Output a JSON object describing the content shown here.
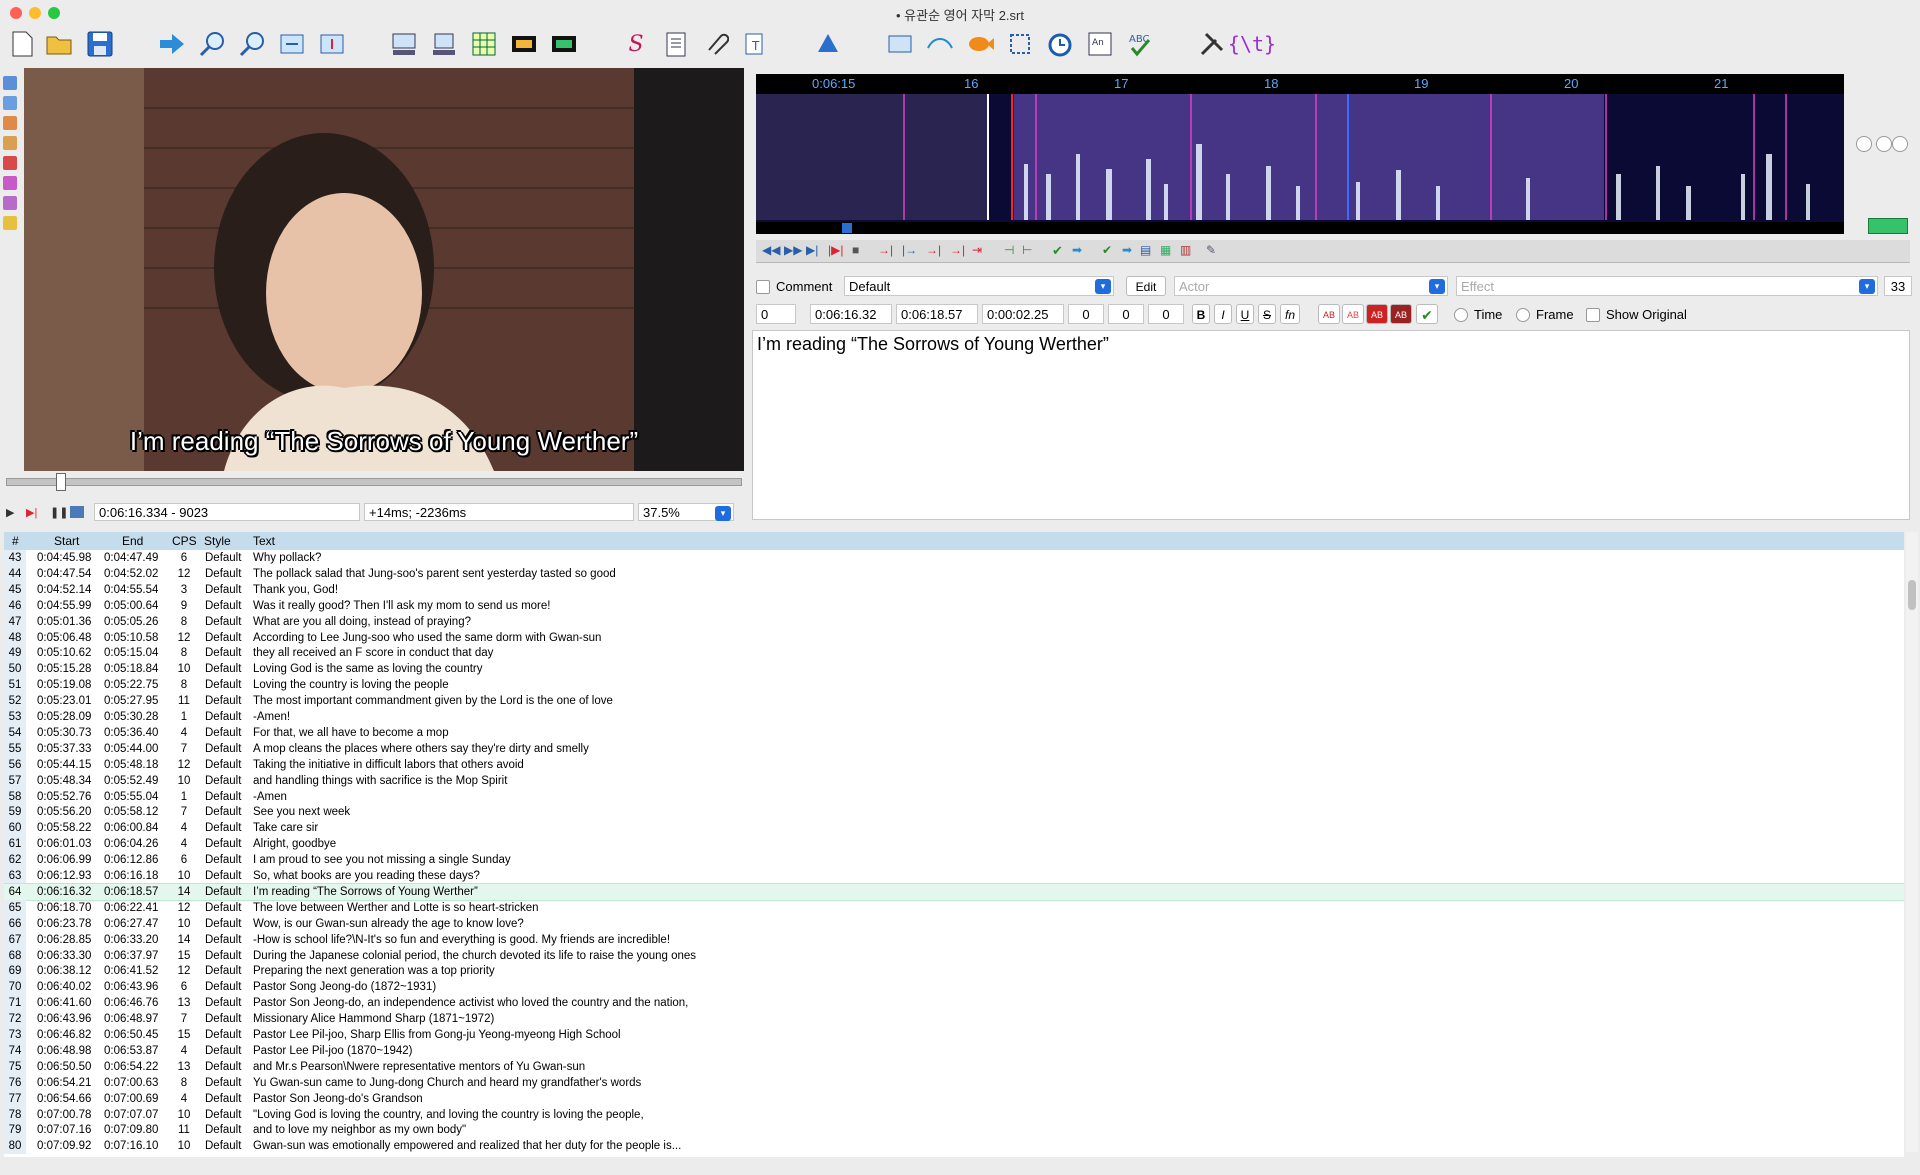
{
  "window": {
    "title": "• 유관순 영어 자막 2.srt"
  },
  "toolbar": {
    "icons": [
      "new-icon",
      "open-icon",
      "save-icon",
      "jump-icon",
      "zoom-in-icon",
      "zoom-out-icon",
      "video-fit-icon",
      "video-detach-icon",
      "layout-1-icon",
      "layout-2-icon",
      "grid-icon",
      "filmstrip-icon",
      "filmstrip-alt-icon",
      "styles-icon",
      "properties-icon",
      "attachments-icon",
      "fonts-icon",
      "automation-icon",
      "translation-icon",
      "timing-icon",
      "fish-icon",
      "select-icon",
      "clock-icon",
      "resample-icon",
      "spellcheck-icon",
      "tools-icon",
      "variables-icon"
    ]
  },
  "video": {
    "subtitle_overlay": "I’m reading “The Sorrows of Young Werther”",
    "position": "0:06:16.334 - 9023",
    "offset": "+14ms; -2236ms",
    "zoom": "37.5%"
  },
  "audio": {
    "ruler": [
      "0:06:15",
      "16",
      "17",
      "18",
      "19",
      "20",
      "21"
    ]
  },
  "editor": {
    "comment_label": "Comment",
    "style": "Default",
    "edit_label": "Edit",
    "actor_placeholder": "Actor",
    "effect_placeholder": "Effect",
    "char_count": "33",
    "layer": "0",
    "start": "0:06:16.32",
    "end": "0:06:18.57",
    "duration": "0:00:02.25",
    "margin_l": "0",
    "margin_r": "0",
    "margin_v": "0",
    "bold": "B",
    "italic": "I",
    "underline": "U",
    "strike": "S",
    "font": "fn",
    "ab": "AB",
    "time_label": "Time",
    "frame_label": "Frame",
    "show_original_label": "Show Original",
    "text": "I’m reading “The Sorrows of Young Werther”"
  },
  "grid": {
    "headers": {
      "num": "#",
      "start": "Start",
      "end": "End",
      "cps": "CPS",
      "style": "Style",
      "text": "Text"
    },
    "rows": [
      {
        "n": "43",
        "s": "0:04:45.98",
        "e": "0:04:47.49",
        "c": "6",
        "st": "Default",
        "t": "Why pollack?"
      },
      {
        "n": "44",
        "s": "0:04:47.54",
        "e": "0:04:52.02",
        "c": "12",
        "st": "Default",
        "t": "The pollack salad that Jung-soo's parent sent yesterday tasted so good"
      },
      {
        "n": "45",
        "s": "0:04:52.14",
        "e": "0:04:55.54",
        "c": "3",
        "st": "Default",
        "t": "Thank you, God!"
      },
      {
        "n": "46",
        "s": "0:04:55.99",
        "e": "0:05:00.64",
        "c": "9",
        "st": "Default",
        "t": "Was it really good? Then I'll ask my mom to send us more!"
      },
      {
        "n": "47",
        "s": "0:05:01.36",
        "e": "0:05:05.26",
        "c": "8",
        "st": "Default",
        "t": "What are you all doing, instead of praying?"
      },
      {
        "n": "48",
        "s": "0:05:06.48",
        "e": "0:05:10.58",
        "c": "12",
        "st": "Default",
        "t": "According to Lee Jung-soo who used the same dorm with Gwan-sun"
      },
      {
        "n": "49",
        "s": "0:05:10.62",
        "e": "0:05:15.04",
        "c": "8",
        "st": "Default",
        "t": "they all received an F score in conduct that day"
      },
      {
        "n": "50",
        "s": "0:05:15.28",
        "e": "0:05:18.84",
        "c": "10",
        "st": "Default",
        "t": "Loving God is the same as loving the country"
      },
      {
        "n": "51",
        "s": "0:05:19.08",
        "e": "0:05:22.75",
        "c": "8",
        "st": "Default",
        "t": "Loving the country is loving the people"
      },
      {
        "n": "52",
        "s": "0:05:23.01",
        "e": "0:05:27.95",
        "c": "11",
        "st": "Default",
        "t": "The most important commandment given by the Lord is the one of love"
      },
      {
        "n": "53",
        "s": "0:05:28.09",
        "e": "0:05:30.28",
        "c": "1",
        "st": "Default",
        "t": "-Amen!"
      },
      {
        "n": "54",
        "s": "0:05:30.73",
        "e": "0:05:36.40",
        "c": "4",
        "st": "Default",
        "t": "For that, we all have to become a mop"
      },
      {
        "n": "55",
        "s": "0:05:37.33",
        "e": "0:05:44.00",
        "c": "7",
        "st": "Default",
        "t": "A mop cleans the places where others say they're dirty and smelly"
      },
      {
        "n": "56",
        "s": "0:05:44.15",
        "e": "0:05:48.18",
        "c": "12",
        "st": "Default",
        "t": "Taking the initiative in difficult labors that others avoid"
      },
      {
        "n": "57",
        "s": "0:05:48.34",
        "e": "0:05:52.49",
        "c": "10",
        "st": "Default",
        "t": "and handling things with sacrifice is the Mop Spirit"
      },
      {
        "n": "58",
        "s": "0:05:52.76",
        "e": "0:05:55.04",
        "c": "1",
        "st": "Default",
        "t": "-Amen"
      },
      {
        "n": "59",
        "s": "0:05:56.20",
        "e": "0:05:58.12",
        "c": "7",
        "st": "Default",
        "t": "See you next week"
      },
      {
        "n": "60",
        "s": "0:05:58.22",
        "e": "0:06:00.84",
        "c": "4",
        "st": "Default",
        "t": "Take care sir"
      },
      {
        "n": "61",
        "s": "0:06:01.03",
        "e": "0:06:04.26",
        "c": "4",
        "st": "Default",
        "t": "Alright, goodbye"
      },
      {
        "n": "62",
        "s": "0:06:06.99",
        "e": "0:06:12.86",
        "c": "6",
        "st": "Default",
        "t": "I am proud to see you not missing a single Sunday"
      },
      {
        "n": "63",
        "s": "0:06:12.93",
        "e": "0:06:16.18",
        "c": "10",
        "st": "Default",
        "t": "So, what books are you reading these days?"
      },
      {
        "n": "64",
        "s": "0:06:16.32",
        "e": "0:06:18.57",
        "c": "14",
        "st": "Default",
        "t": "I’m reading “The Sorrows of Young Werther”"
      },
      {
        "n": "65",
        "s": "0:06:18.70",
        "e": "0:06:22.41",
        "c": "12",
        "st": "Default",
        "t": "The love between Werther and Lotte is so heart-stricken"
      },
      {
        "n": "66",
        "s": "0:06:23.78",
        "e": "0:06:27.47",
        "c": "10",
        "st": "Default",
        "t": "Wow, is our Gwan-sun already the age to know love?"
      },
      {
        "n": "67",
        "s": "0:06:28.85",
        "e": "0:06:33.20",
        "c": "14",
        "st": "Default",
        "t": "-How is school life?\\N-It's so fun and everything is good. My friends are incredible!"
      },
      {
        "n": "68",
        "s": "0:06:33.30",
        "e": "0:06:37.97",
        "c": "15",
        "st": "Default",
        "t": "During the Japanese colonial period, the church devoted its life to raise the young ones"
      },
      {
        "n": "69",
        "s": "0:06:38.12",
        "e": "0:06:41.52",
        "c": "12",
        "st": "Default",
        "t": "Preparing the next generation was a top priority"
      },
      {
        "n": "70",
        "s": "0:06:40.02",
        "e": "0:06:43.96",
        "c": "6",
        "st": "Default",
        "t": "Pastor Song Jeong-do (1872~1931)"
      },
      {
        "n": "71",
        "s": "0:06:41.60",
        "e": "0:06:46.76",
        "c": "13",
        "st": "Default",
        "t": "Pastor Son Jeong-do, an independence activist who loved the country and the nation,"
      },
      {
        "n": "72",
        "s": "0:06:43.96",
        "e": "0:06:48.97",
        "c": "7",
        "st": "Default",
        "t": "Missionary Alice Hammond Sharp (1871~1972)"
      },
      {
        "n": "73",
        "s": "0:06:46.82",
        "e": "0:06:50.45",
        "c": "15",
        "st": "Default",
        "t": "Pastor Lee Pil-joo, Sharp Ellis from Gong-ju Yeong-myeong High School"
      },
      {
        "n": "74",
        "s": "0:06:48.98",
        "e": "0:06:53.87",
        "c": "4",
        "st": "Default",
        "t": "Pastor Lee Pil-joo (1870~1942)"
      },
      {
        "n": "75",
        "s": "0:06:50.50",
        "e": "0:06:54.22",
        "c": "13",
        "st": "Default",
        "t": "and Mr.s Pearson\\Nwere representative mentors of Yu Gwan-sun"
      },
      {
        "n": "76",
        "s": "0:06:54.21",
        "e": "0:07:00.63",
        "c": "8",
        "st": "Default",
        "t": "Yu Gwan-sun came to Jung-dong Church and heard my grandfather's words"
      },
      {
        "n": "77",
        "s": "0:06:54.66",
        "e": "0:07:00.69",
        "c": "4",
        "st": "Default",
        "t": "Pastor Son Jeong-do's Grandson"
      },
      {
        "n": "78",
        "s": "0:07:00.78",
        "e": "0:07:07.07",
        "c": "10",
        "st": "Default",
        "t": "\"Loving God is loving the country, and loving the country is loving the people,"
      },
      {
        "n": "79",
        "s": "0:07:07.16",
        "e": "0:07:09.80",
        "c": "11",
        "st": "Default",
        "t": "and to love my neighbor as my own body\""
      },
      {
        "n": "80",
        "s": "0:07:09.92",
        "e": "0:07:16.10",
        "c": "10",
        "st": "Default",
        "t": "Gwan-sun was emotionally empowered and realized that her duty for the people is..."
      }
    ]
  }
}
